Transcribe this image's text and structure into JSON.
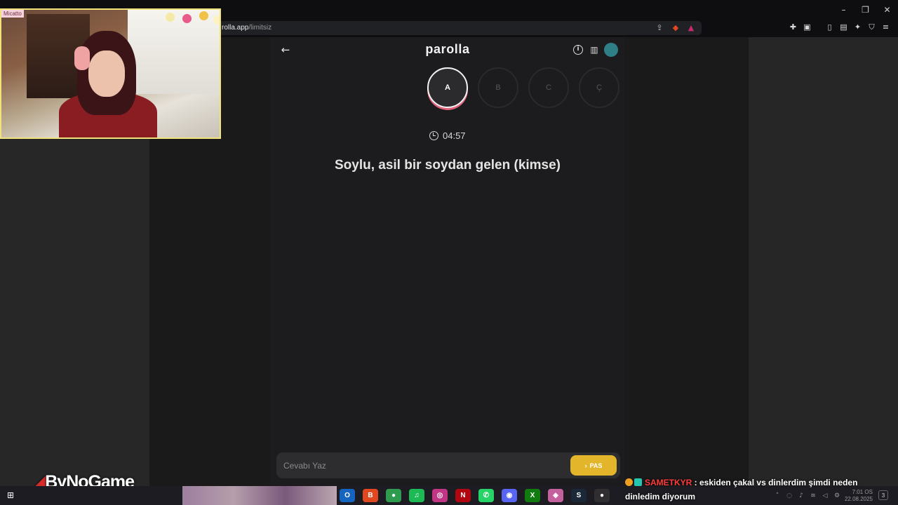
{
  "browser": {
    "url": "rolla.app",
    "url_path": "/limitsiz",
    "window_controls": [
      "minimize-icon",
      "maximize-icon",
      "close-icon"
    ],
    "extensions": [
      "puzzle-icon",
      "tab-icon",
      "sidebar-icon",
      "wallet-icon",
      "sparkle-icon",
      "shield-icon",
      "menu-icon"
    ]
  },
  "app": {
    "title": "parolla",
    "letters": [
      {
        "label": "A",
        "active": true
      },
      {
        "label": "B",
        "active": false
      },
      {
        "label": "C",
        "active": false
      },
      {
        "label": "Ç",
        "active": false
      }
    ],
    "timer": "04:57",
    "question": "Soylu, asil bir soydan gelen (kimse)",
    "answer_placeholder": "Cevabı Yaz",
    "pass_label": "PAS",
    "pass_icon": "›",
    "info_icon": "i",
    "stats_icon": "▥",
    "back_icon": "←",
    "accent_color": "#e3b52a",
    "ring_color": "#e0627a"
  },
  "overlay": {
    "webcam_label": "Micatto",
    "brand": "ByNoGame",
    "chat": {
      "user": "SAMETKYR",
      "message": " : eskiden çakal vs dinlerdim şimdi neden dinledim diyorum"
    }
  },
  "taskbar": {
    "start_icon": "⊞",
    "apps": [
      {
        "name": "outlook",
        "glyph": "O",
        "color": "#1565c0"
      },
      {
        "name": "brave",
        "glyph": "B",
        "color": "#e2481f"
      },
      {
        "name": "chrome",
        "glyph": "●",
        "color": "#2e9b4f"
      },
      {
        "name": "spotify",
        "glyph": "♫",
        "color": "#1db954"
      },
      {
        "name": "instagram",
        "glyph": "◎",
        "color": "#c13584"
      },
      {
        "name": "netflix",
        "glyph": "N",
        "color": "#b20710"
      },
      {
        "name": "whatsapp",
        "glyph": "✆",
        "color": "#25d366"
      },
      {
        "name": "discord",
        "glyph": "◉",
        "color": "#5865f2"
      },
      {
        "name": "xbox",
        "glyph": "X",
        "color": "#107c10"
      },
      {
        "name": "photos",
        "glyph": "◈",
        "color": "#c4609e"
      },
      {
        "name": "steam",
        "glyph": "S",
        "color": "#1b2838"
      },
      {
        "name": "obs",
        "glyph": "●",
        "color": "#302e31"
      }
    ],
    "clock_time": "7:01 OS",
    "clock_date": "22.08.2025",
    "notifications": "3"
  }
}
